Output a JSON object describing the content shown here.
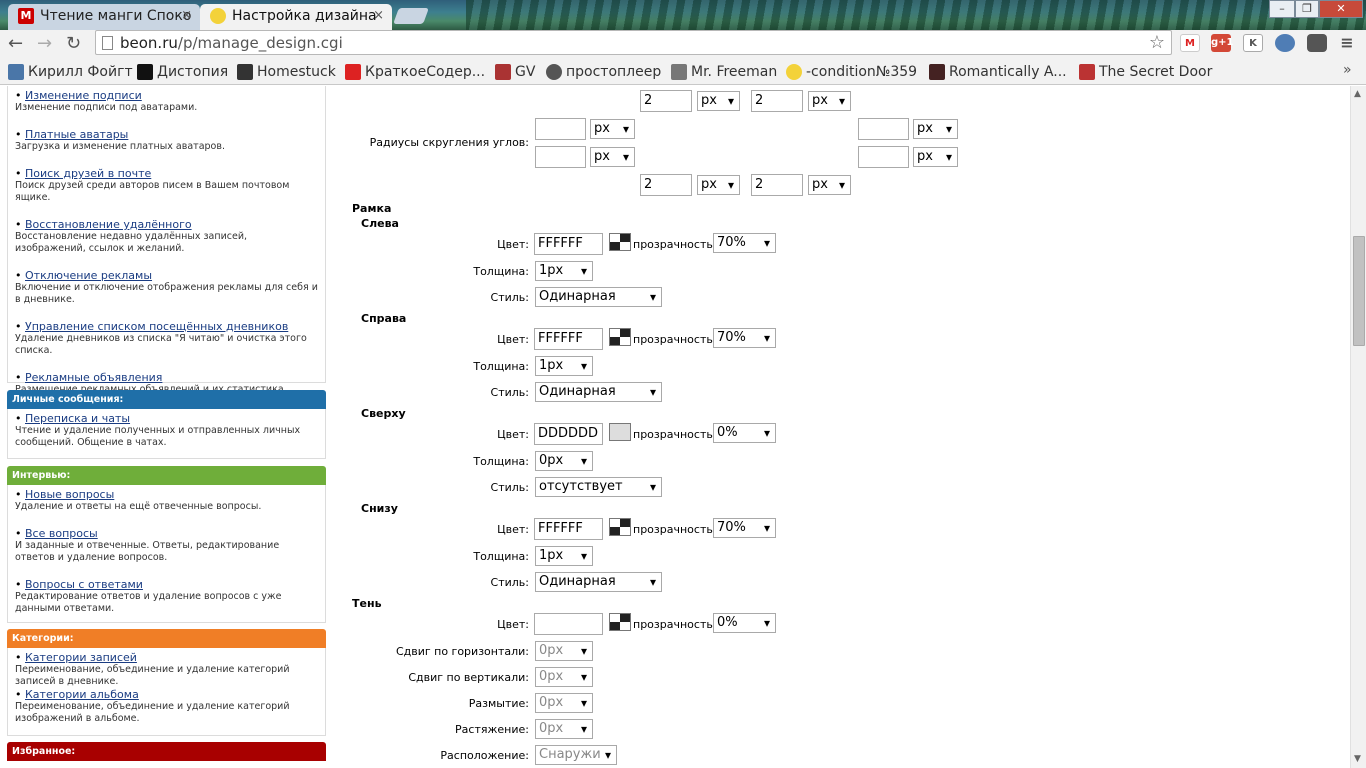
{
  "browser": {
    "tabs": [
      {
        "title": "Чтение манги Споко",
        "close": "×"
      },
      {
        "title": "Настройка дизайна",
        "close": "×"
      }
    ],
    "url_domain": "beon.ru",
    "url_path": "/p/manage_design.cgi",
    "bookmarks": [
      "Кирилл Фойгт",
      "Дистопия",
      "Homestuck",
      "КраткоеСодер...",
      "GV",
      "простоплеер",
      "Mr. Freeman",
      "-condition№359",
      "Romantically A...",
      "The Secret Door"
    ],
    "extensions": {
      "gmail": "M",
      "gplus": "g+1",
      "k": "K"
    },
    "menu_icon": "≡",
    "win_minimize": "–",
    "win_maximize": "❐",
    "win_close": "✕"
  },
  "sidebar": {
    "top_items": [
      {
        "link": "Изменение подписи",
        "desc": "Изменение подписи под аватарами."
      },
      {
        "link": "Платные аватары",
        "desc": "Загрузка и изменение платных аватаров."
      },
      {
        "link": "Поиск друзей в почте",
        "desc": "Поиск друзей среди авторов писем в Вашем почтовом ящике."
      },
      {
        "link": "Восстановление удалённого",
        "desc": "Восстановление недавно удалённых записей, изображений, ссылок и желаний."
      },
      {
        "link": "Отключение рекламы",
        "desc": "Включение и отключение отображения рекламы для себя и в дневнике."
      },
      {
        "link": "Управление списком посещённых дневников",
        "desc": "Удаление дневников из списка \"Я читаю\" и очистка этого списка."
      },
      {
        "link": "Рекламные объявления",
        "desc": "Размещение рекламных объявлений и их статистика."
      }
    ],
    "messages": {
      "header": "Личные сообщения:",
      "color": "#1f6fa8",
      "items": [
        {
          "link": "Переписка и чаты",
          "desc": "Чтение и удаление полученных и отправленных личных сообщений. Общение в чатах."
        }
      ]
    },
    "interview": {
      "header": "Интервью:",
      "color": "#6fae3a",
      "items": [
        {
          "link": "Новые вопросы",
          "desc": "Удаление и ответы на ещё отвеченные вопросы."
        },
        {
          "link": "Все вопросы",
          "desc": "И заданные и отвеченные. Ответы, редактирование ответов и удаление вопросов."
        },
        {
          "link": "Вопросы с ответами",
          "desc": "Редактирование ответов и удаление вопросов с уже данными ответами."
        }
      ]
    },
    "categories": {
      "header": "Категории:",
      "color": "#f07e26",
      "items": [
        {
          "link": "Категории записей",
          "desc": "Переименование, объединение и удаление категорий записей в дневнике."
        },
        {
          "link": "Категории альбома",
          "desc": "Переименование, объединение и удаление категорий изображений в альбоме."
        }
      ]
    },
    "favorites": {
      "header": "Избранное:",
      "color": "#a80000"
    }
  },
  "form": {
    "padding_top": {
      "left_value": "2",
      "left_unit": "px",
      "right_value": "2",
      "right_unit": "px"
    },
    "corner_radius": {
      "label": "Радиусы скругления углов:",
      "tl_value": "",
      "tl_unit": "px",
      "tr_value": "",
      "tr_unit": "px",
      "bl_value": "",
      "bl_unit": "px",
      "br_value": "",
      "br_unit": "px"
    },
    "padding_bottom": {
      "left_value": "2",
      "left_unit": "px",
      "right_value": "2",
      "right_unit": "px"
    },
    "border_title": "Рамка",
    "labels": {
      "color": "Цвет:",
      "opacity": "прозрачность:",
      "thickness": "Толщина:",
      "style": "Стиль:"
    },
    "border_left": {
      "title": "Слева",
      "color": "FFFFFF",
      "opacity": "70%",
      "thickness": "1px",
      "style": "Одинарная"
    },
    "border_right": {
      "title": "Справа",
      "color": "FFFFFF",
      "opacity": "70%",
      "thickness": "1px",
      "style": "Одинарная"
    },
    "border_top": {
      "title": "Сверху",
      "color": "DDDDDD",
      "opacity": "0%",
      "thickness": "0px",
      "style": "отсутствует"
    },
    "border_bottom": {
      "title": "Снизу",
      "color": "FFFFFF",
      "opacity": "70%",
      "thickness": "1px",
      "style": "Одинарная"
    },
    "shadow": {
      "title": "Тень",
      "color_label": "Цвет:",
      "color": "",
      "opacity_label": "прозрачность:",
      "opacity": "0%",
      "h_offset_label": "Сдвиг по горизонтали:",
      "h_offset": "0px",
      "v_offset_label": "Сдвиг по вертикали:",
      "v_offset": "0px",
      "blur_label": "Размытие:",
      "blur": "0px",
      "spread_label": "Растяжение:",
      "spread": "0px",
      "position_label": "Расположение:",
      "position": "Снаружи"
    }
  }
}
